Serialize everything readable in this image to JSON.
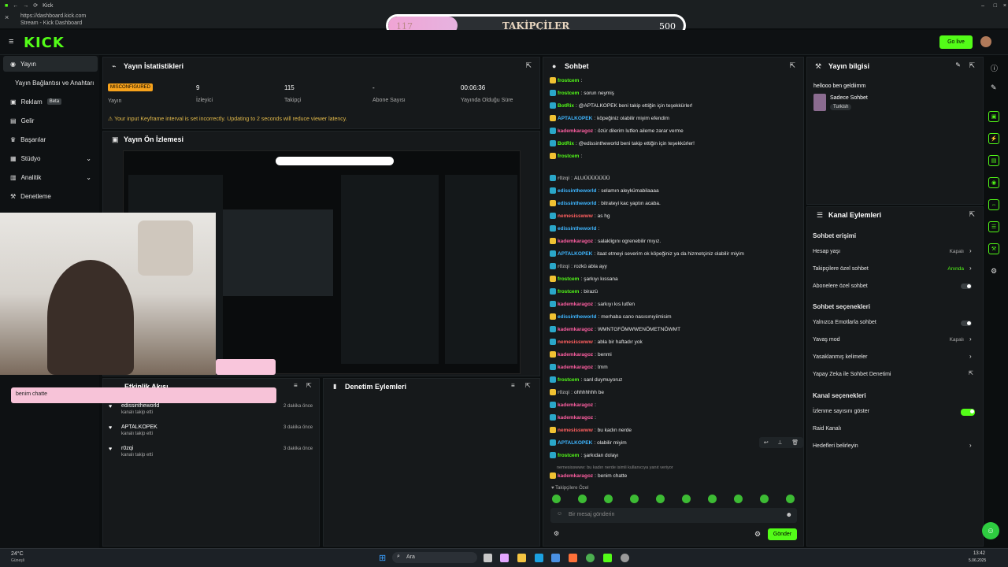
{
  "browser": {
    "tab_title": "Kick",
    "url": "https://dashboard.kick.com",
    "page_title": "Stream - Kick Dashboard"
  },
  "follower_goal": {
    "current": "117",
    "label": "TAKİPÇİLER",
    "target": "500",
    "progress": 0.234
  },
  "header": {
    "logo": "KICK",
    "go_live_label": "Go live"
  },
  "sidebar": {
    "items": [
      {
        "label": "Yayın",
        "icon": "broadcast-icon",
        "active": true
      },
      {
        "label": "Yayın Bağlantısı ve Anahtarı",
        "icon": "",
        "active": false
      },
      {
        "label": "Reklam",
        "icon": "ad-icon",
        "badge": "Beta"
      },
      {
        "label": "Gelir",
        "icon": "money-icon"
      },
      {
        "label": "Başarılar",
        "icon": "trophy-icon"
      },
      {
        "label": "Stüdyo",
        "icon": "studio-icon",
        "chevron": true
      },
      {
        "label": "Analitik",
        "icon": "chart-icon",
        "chevron": true
      },
      {
        "label": "Denetleme",
        "icon": "hammer-icon"
      }
    ]
  },
  "stats": {
    "title": "Yayın İstatistikleri",
    "status_badge": "MISCONFIGURED",
    "status_label": "Yayın",
    "viewers": {
      "value": "9",
      "label": "İzleyici"
    },
    "followers": {
      "value": "115",
      "label": "Takipçi"
    },
    "subs": {
      "value": "-",
      "label": "Abone Sayısı"
    },
    "uptime": {
      "value": "00:06:36",
      "label": "Yayında Olduğu Süre"
    },
    "warning": "Your input Keyframe interval is set incorrectly. Updating to 2 seconds will reduce viewer latency."
  },
  "preview": {
    "title": "Yayın Ön İzlemesi"
  },
  "activity": {
    "title": "Etkinlik Akışı",
    "overlay_msg": "benim chatte",
    "events": [
      {
        "user": "edissintheworld",
        "action": "kanalı takip etti",
        "time": "2 dakika önce"
      },
      {
        "user": "APTALKOPEK",
        "action": "kanalı takip etti",
        "time": "3 dakika önce"
      },
      {
        "user": "r0zqi",
        "action": "kanalı takip etti",
        "time": "3 dakika önce"
      }
    ]
  },
  "moderation": {
    "title": "Denetim Eylemleri"
  },
  "chat": {
    "title": "Sohbet",
    "placeholder": "Bir mesaj gönderin",
    "send_label": "Gönder",
    "followers_only_note": "Takipçilere Özel",
    "reply_context": "nemesisswww: bu kadın nerde isimli kullanıcıya yanıt veriyor",
    "messages": [
      {
        "user": "frostcem",
        "text": "",
        "color": "#53fc18"
      },
      {
        "user": "frostcem",
        "text": "sorun neymiş",
        "color": "#53fc18"
      },
      {
        "user": "BotRix",
        "text": "@APTALKOPEK beni takip ettiğin için teşekkürler!",
        "color": "#53fc18"
      },
      {
        "user": "APTALKOPEK",
        "text": "köpeğiniz olabilir miyim efendim",
        "color": "#3fb6ff"
      },
      {
        "user": "kademkaragoz",
        "text": "özür dilerim lutfen aileme zarar verme",
        "color": "#ff5fa2"
      },
      {
        "user": "BotRix",
        "text": "@edissintheworld beni takip ettiğin için teşekkürler!",
        "color": "#53fc18"
      },
      {
        "user": "frostcem",
        "text": "",
        "color": "#53fc18"
      },
      {
        "user": "r0zqi",
        "text": "ALUÜÜÜÜÜÜÜ",
        "color": "#9a9a9a"
      },
      {
        "user": "edissintheworld",
        "text": "selamın aleykümabilaaaa",
        "color": "#3fb6ff"
      },
      {
        "user": "edissintheworld",
        "text": "bitrateyi kac yaptın acaba.",
        "color": "#3fb6ff"
      },
      {
        "user": "nemesisswww",
        "text": "as hg",
        "color": "#ff5f5f"
      },
      {
        "user": "edissintheworld",
        "text": "",
        "color": "#3fb6ff"
      },
      {
        "user": "kademkaragoz",
        "text": "salakligını ogrenebilir mıyız.",
        "color": "#ff5fa2"
      },
      {
        "user": "APTALKOPEK",
        "text": "itaat etmeyi severim ok köpeğiniz ya da hizmetçiniz olabilir miyim",
        "color": "#3fb6ff"
      },
      {
        "user": "r0zqi",
        "text": "rozkü abla ayy",
        "color": "#9a9a9a"
      },
      {
        "user": "frostcem",
        "text": "şarkıyı kıssana",
        "color": "#53fc18"
      },
      {
        "user": "frostcem",
        "text": "birazü",
        "color": "#53fc18"
      },
      {
        "user": "kademkaragoz",
        "text": "sarkıyı kıs lutfen",
        "color": "#ff5fa2"
      },
      {
        "user": "edissintheworld",
        "text": "merhaba cano nasısınıyiimisim",
        "color": "#3fb6ff"
      },
      {
        "user": "kademkaragoz",
        "text": "WMNTGFÖMWWENÖMETNÖWMT",
        "color": "#ff5fa2"
      },
      {
        "user": "nemesisswww",
        "text": "abla bir haftadır yok",
        "color": "#ff5f5f"
      },
      {
        "user": "kademkaragoz",
        "text": "benmi",
        "color": "#ff5fa2"
      },
      {
        "user": "kademkaragoz",
        "text": "tmm",
        "color": "#ff5fa2"
      },
      {
        "user": "frostcem",
        "text": "sanl duymuyoruz",
        "color": "#53fc18"
      },
      {
        "user": "r0zqi",
        "text": "ohhhhhhh be",
        "color": "#9a9a9a"
      },
      {
        "user": "kademkaragoz",
        "text": "",
        "color": "#ff5fa2"
      },
      {
        "user": "kademkaragoz",
        "text": "",
        "color": "#ff5fa2"
      },
      {
        "user": "nemesisswww",
        "text": "bu kadın nerde",
        "color": "#ff5f5f"
      },
      {
        "user": "APTALKOPEK",
        "text": "olabilir miyim",
        "color": "#3fb6ff"
      },
      {
        "user": "frostcem",
        "text": "şarkıdan dolayı",
        "color": "#53fc18"
      },
      {
        "user": "kademkaragoz",
        "text": "benim chatte",
        "color": "#ff5fa2"
      }
    ]
  },
  "stream_info": {
    "title": "Yayın bilgisi",
    "stream_title": "hellooo ben geldiimm",
    "category": "Sadece Sohbet",
    "language": "Turkish"
  },
  "channel_actions": {
    "title": "Kanal Eylemleri",
    "chat_access": "Sohbet erişimi",
    "account_age": {
      "label": "Hesap yaşı",
      "value": "Kapalı"
    },
    "followers_chat": {
      "label": "Takipçilere özel sohbet",
      "value": "Anında"
    },
    "subs_chat": {
      "label": "Abonelere özel sohbet"
    },
    "chat_options": "Sohbet seçenekleri",
    "emote_only": {
      "label": "Yalnızca Emotlarla sohbet"
    },
    "slow_mode": {
      "label": "Yavaş mod",
      "value": "Kapalı"
    },
    "banned_words": {
      "label": "Yasaklanmış kelimeler"
    },
    "ai_moderation": {
      "label": "Yapay Zeka ile Sohbet Denetimi"
    },
    "channel_options": "Kanal seçenekleri",
    "show_viewers": {
      "label": "İzlenme sayısını göster"
    },
    "raid": {
      "label": "Raid Kanalı"
    },
    "goals": {
      "label": "Hedefleri belirleyin"
    }
  },
  "taskbar": {
    "weather": "24°C",
    "weather_sub": "Güneşli",
    "search": "Ara",
    "time": "13:42",
    "date": "5.06.2025"
  }
}
